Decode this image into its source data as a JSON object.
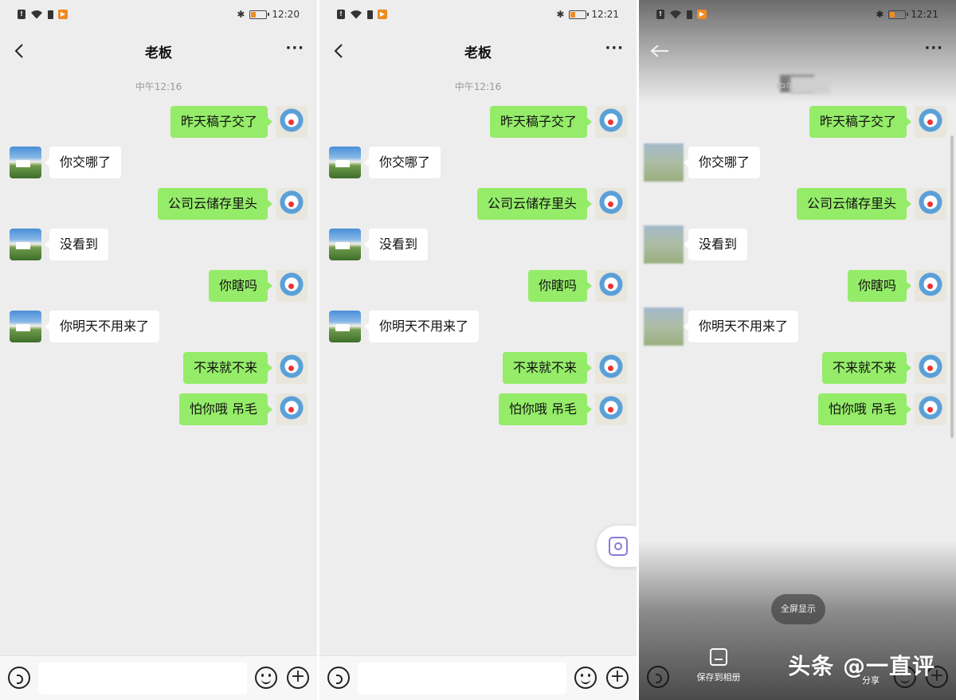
{
  "panels": [
    {
      "status": {
        "time": "12:20",
        "battery_level": 0.3
      },
      "title": "老板",
      "more": "···",
      "timestamp": "中午12:16",
      "messages": [
        {
          "from": "me",
          "text": "昨天稿子交了"
        },
        {
          "from": "other",
          "text": "你交哪了"
        },
        {
          "from": "me",
          "text": "公司云储存里头"
        },
        {
          "from": "other",
          "text": "没看到"
        },
        {
          "from": "me",
          "text": "你瞎吗"
        },
        {
          "from": "other",
          "text": "你明天不用来了"
        },
        {
          "from": "me",
          "text": "不来就不来"
        },
        {
          "from": "me",
          "text": "怕你哦 吊毛"
        }
      ]
    },
    {
      "status": {
        "time": "12:21",
        "battery_level": 0.3
      },
      "title": "老板",
      "more": "···",
      "timestamp": "中午12:16",
      "messages": [
        {
          "from": "me",
          "text": "昨天稿子交了"
        },
        {
          "from": "other",
          "text": "你交哪了"
        },
        {
          "from": "me",
          "text": "公司云储存里头"
        },
        {
          "from": "other",
          "text": "没看到"
        },
        {
          "from": "me",
          "text": "你瞎吗"
        },
        {
          "from": "other",
          "text": "你明天不用来了"
        },
        {
          "from": "me",
          "text": "不来就不来"
        },
        {
          "from": "me",
          "text": "怕你哦 吊毛"
        }
      ],
      "screenshot_button_icon": "camera-icon"
    },
    {
      "status": {
        "time": "12:21",
        "battery_level": 0.3
      },
      "more": "···",
      "timestamp_partial": "中午",
      "messages": [
        {
          "from": "me",
          "text": "昨天稿子交了"
        },
        {
          "from": "other",
          "text": "你交哪了"
        },
        {
          "from": "me",
          "text": "公司云储存里头"
        },
        {
          "from": "other",
          "text": "没看到"
        },
        {
          "from": "me",
          "text": "你瞎吗"
        },
        {
          "from": "other",
          "text": "你明天不用来了"
        },
        {
          "from": "me",
          "text": "不来就不来"
        },
        {
          "from": "me",
          "text": "怕你哦 吊毛"
        }
      ],
      "fullscreen_label": "全屏显示",
      "save_label": "保存到相册",
      "share_label": "分享"
    }
  ],
  "watermark": "头条 @一直评",
  "colors": {
    "bubble_me": "#95ec69",
    "bubble_other": "#ffffff",
    "background": "#ededed",
    "battery_accent": "#f08a24"
  }
}
